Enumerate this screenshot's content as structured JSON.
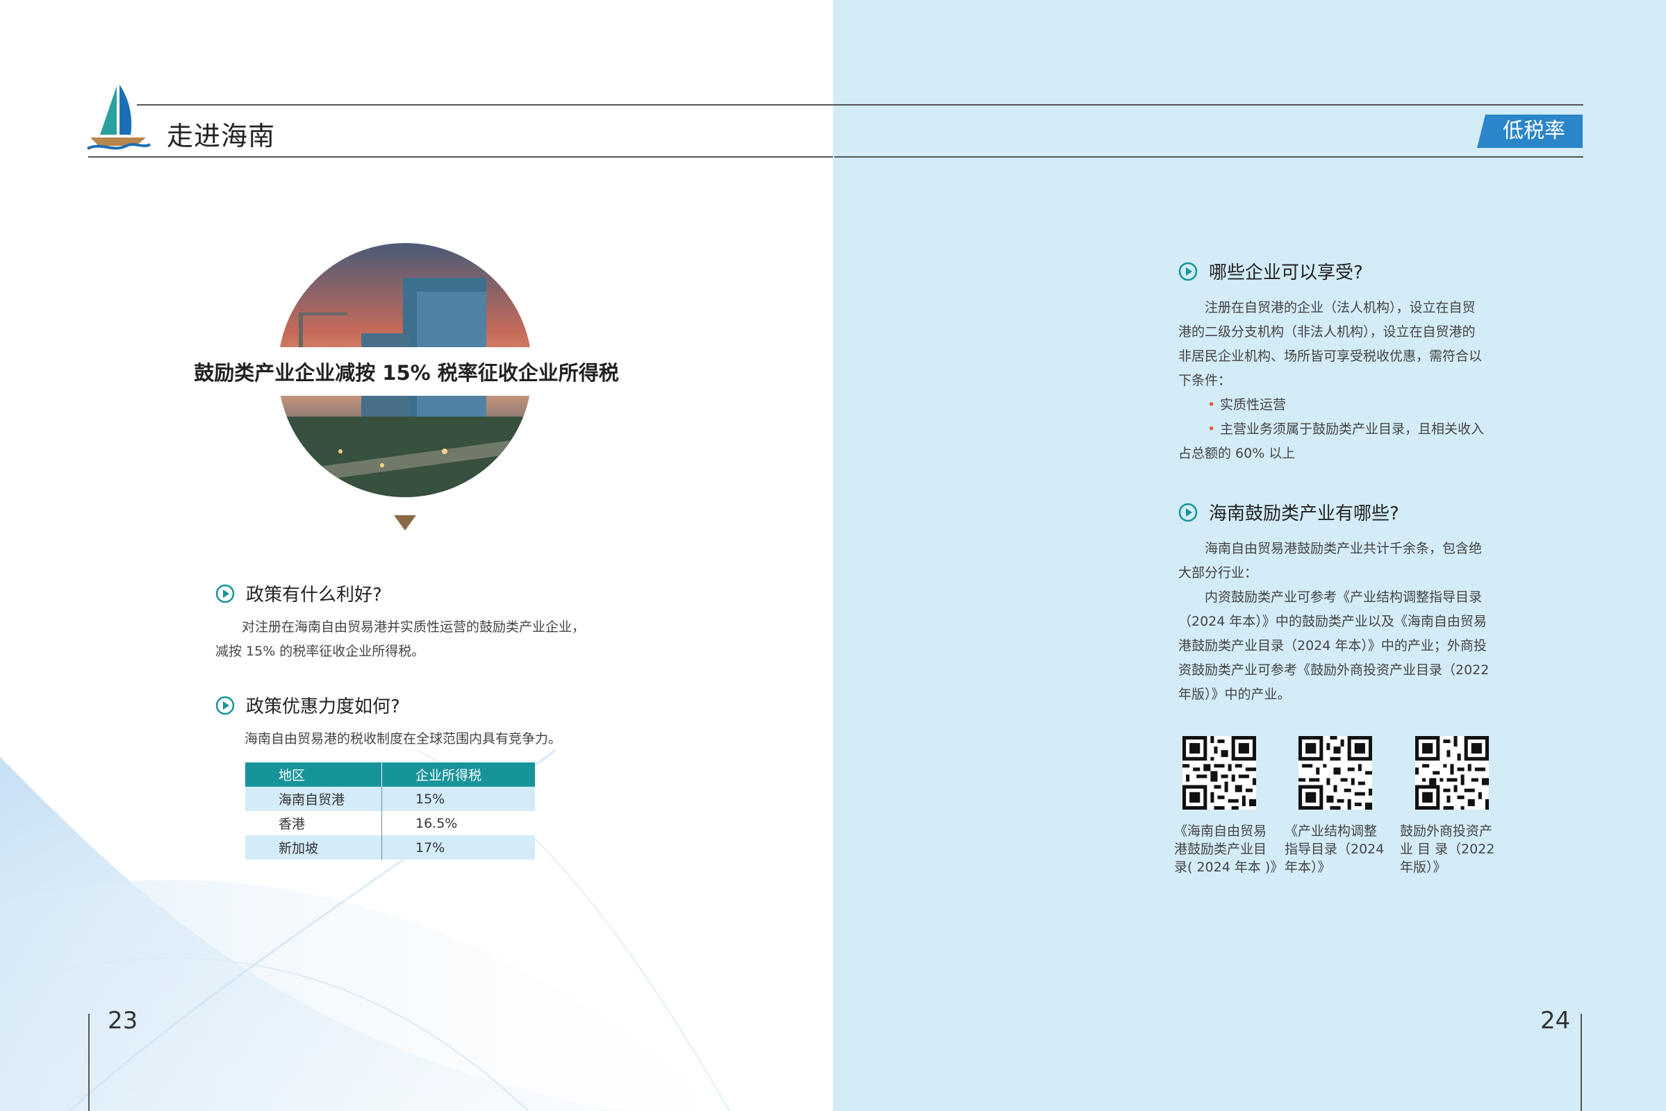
{
  "header": {
    "section_title": "走进海南",
    "tag": "低税率"
  },
  "left": {
    "headline": "鼓励类产业企业减按 15% 税率征收企业所得税",
    "q1": {
      "title": "政策有什么利好?",
      "lines": [
        "对注册在海南自由贸易港并实质性运营的鼓励类产业企业，",
        "减按 15% 的税率征收企业所得税。"
      ]
    },
    "q2": {
      "title": "政策优惠力度如何?",
      "intro": "海南自由贸易港的税收制度在全球范围内具有竞争力。"
    },
    "table": {
      "headers": [
        "地区",
        "企业所得税"
      ],
      "rows": [
        [
          "海南自贸港",
          "15%"
        ],
        [
          "香港",
          "16.5%"
        ],
        [
          "新加坡",
          "17%"
        ]
      ]
    },
    "page_number": "23"
  },
  "right": {
    "q3": {
      "title": "哪些企业可以享受?",
      "lines": [
        "注册在自贸港的企业（法人机构），设立在自贸",
        "港的二级分支机构（非法人机构），设立在自贸港的",
        "非居民企业机构、场所皆可享受税收优惠，需符合以",
        "下条件："
      ],
      "bullets": [
        "实质性运营",
        "主营业务须属于鼓励类产业目录，且相关收入"
      ],
      "tail": "占总额的 60% 以上"
    },
    "q4": {
      "title": "海南鼓励类产业有哪些?",
      "lines": [
        "海南自由贸易港鼓励类产业共计千余条，包含绝",
        "大部分行业：",
        "内资鼓励类产业可参考《产业结构调整指导目录",
        "（2024 年本）》中的鼓励类产业以及《海南自由贸易",
        "港鼓励类产业目录（2024 年本）》中的产业；外商投",
        "资鼓励类产业可参考《鼓励外商投资产业目录（2022",
        "年版）》中的产业。"
      ]
    },
    "qr_codes": [
      {
        "caption": [
          "《海南自由贸易",
          "港鼓励类产业目",
          "录( 2024 年本 )》"
        ]
      },
      {
        "caption": [
          "《产业结构调整",
          "指导目录（2024",
          "年本）》"
        ]
      },
      {
        "caption": [
          "鼓励外商投资产",
          "业 目 录（2022",
          "年版）》"
        ]
      }
    ],
    "page_number": "24"
  },
  "colors": {
    "accent_teal": "#17939a",
    "tag_blue": "#2a86c8",
    "right_bg": "#d3ecf8",
    "bullet_red": "#e05a3a",
    "triangle_brown": "#8a6a45"
  },
  "icons": [
    "sailboat-logo-icon",
    "play-circle-icon",
    "qr-code-icon"
  ]
}
